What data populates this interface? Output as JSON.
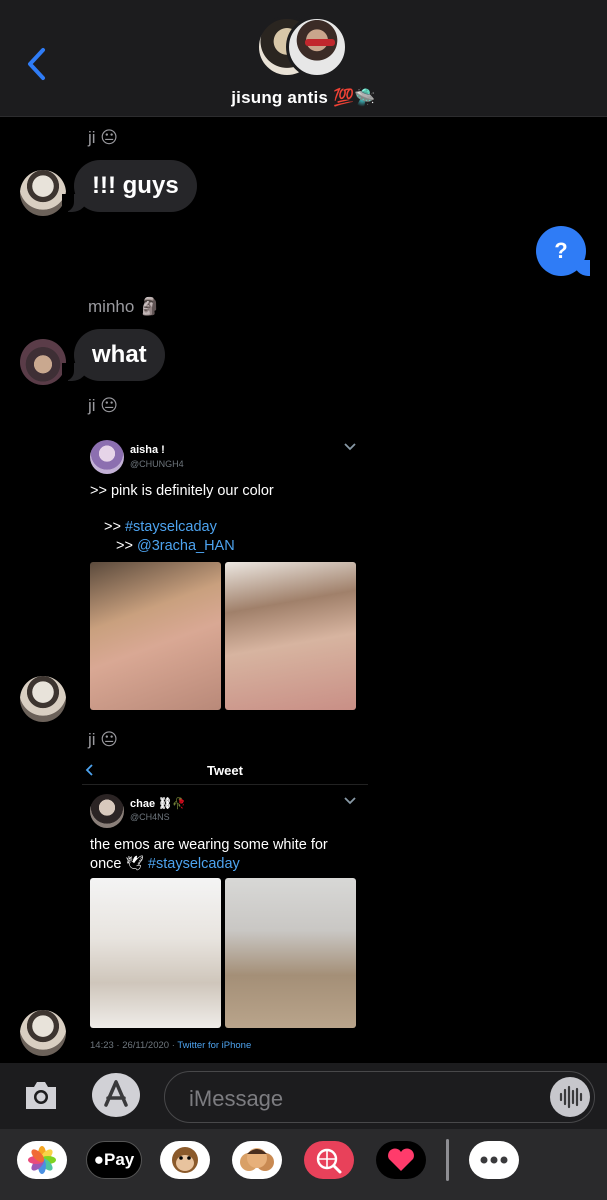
{
  "header": {
    "group_name": "jisung antis 💯🛸"
  },
  "messages": [
    {
      "sender": "ji 😐",
      "text": "!!! guys"
    },
    {
      "outgoing_text": "?"
    },
    {
      "sender": "minho 🗿",
      "text": "what"
    },
    {
      "sender": "ji 😐"
    },
    {
      "sender": "ji 😐"
    }
  ],
  "tweet1": {
    "name": "aisha !",
    "handle": "@CHUNGH4",
    "line1": ">> pink is definitely our color",
    "line2_prefix": ">> ",
    "line2_link": "#stayselcaday",
    "line3_prefix": ">> ",
    "line3_link": "@3racha_HAN"
  },
  "tweet2": {
    "topbar_title": "Tweet",
    "name": "chae ⛓🥀",
    "handle": "@CH4NS",
    "line1": "the emos are wearing some white for",
    "line2_prefix": "once 🕊 ",
    "line2_link": "#stayselcaday",
    "time": "14:23 · 26/11/2020 · ",
    "via": "Twitter for iPhone"
  },
  "input": {
    "placeholder": "iMessage"
  },
  "drawer": {
    "pay_label": "Pay"
  },
  "colors": {
    "accent_blue": "#2f7cf6",
    "link_blue": "#4da3ef",
    "bubble_gray": "#262629"
  }
}
